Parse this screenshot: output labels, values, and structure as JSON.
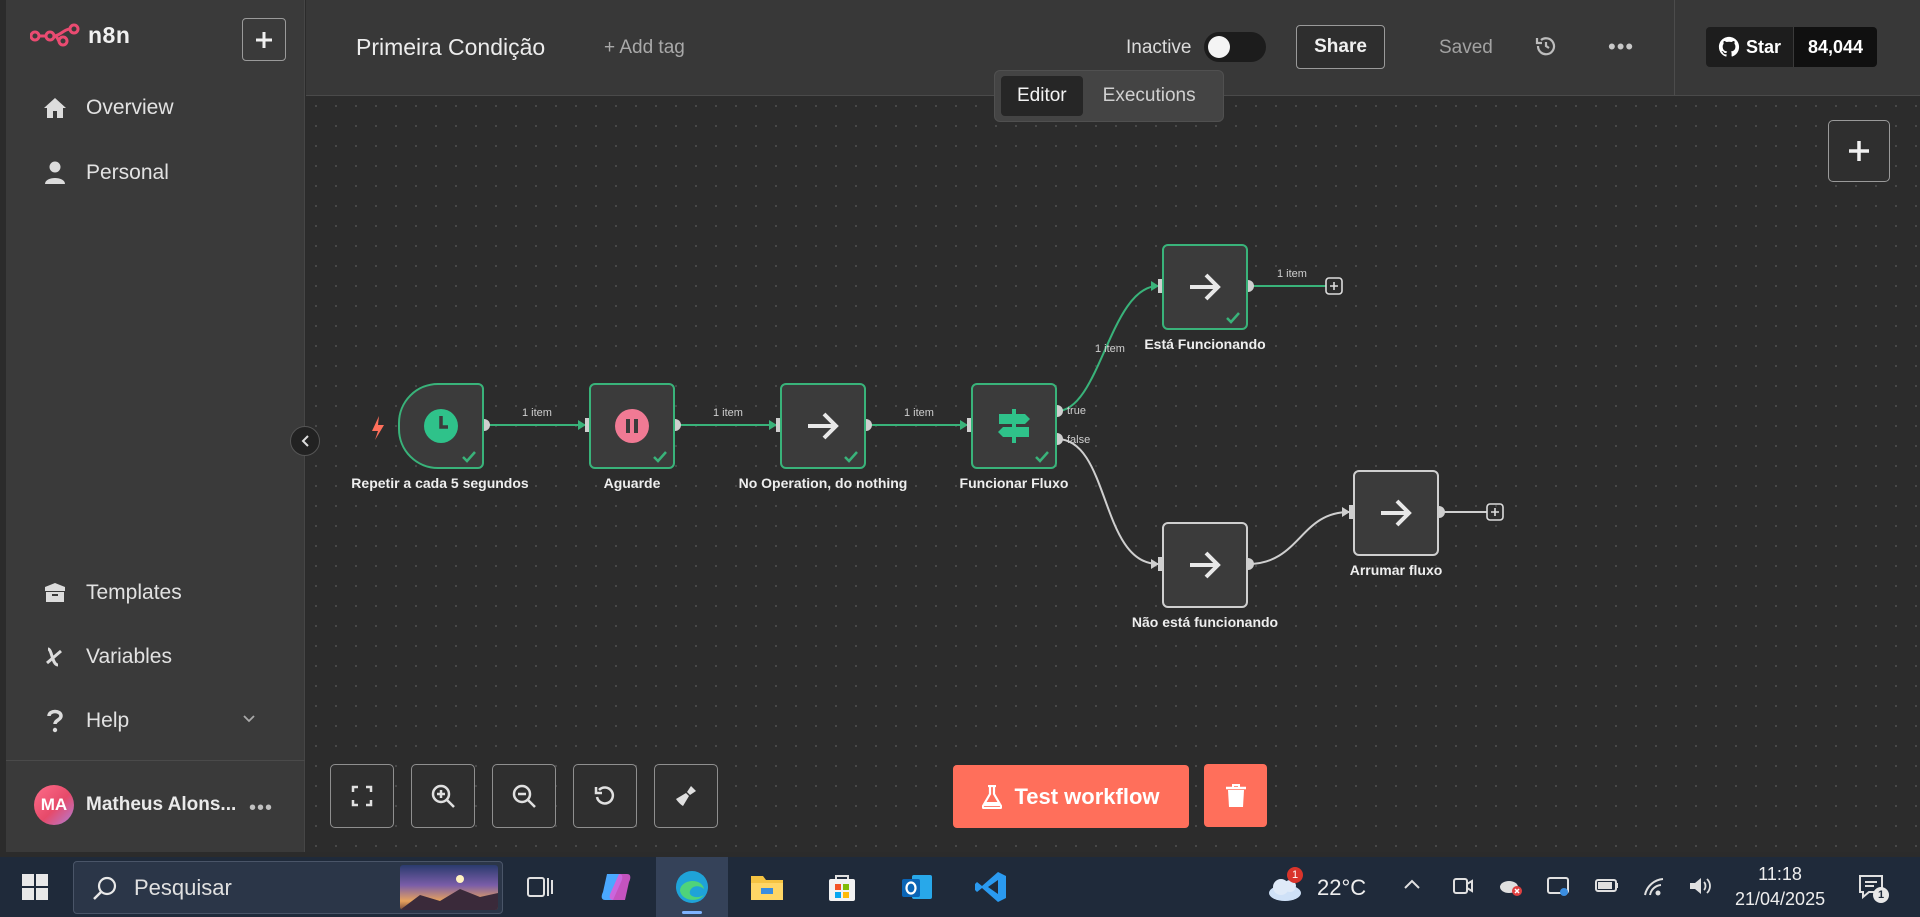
{
  "app": {
    "logo_text": "n8n",
    "nav": {
      "overview": "Overview",
      "personal": "Personal",
      "templates": "Templates",
      "variables": "Variables",
      "help": "Help"
    },
    "user": {
      "initials": "MA",
      "name": "Matheus Alons..."
    }
  },
  "header": {
    "workflow_name": "Primeira Condição",
    "add_tag": "+ Add tag",
    "status_label": "Inactive",
    "share_label": "Share",
    "saved_label": "Saved",
    "github": {
      "star_label": "Star",
      "count": "84,044"
    }
  },
  "tabs": {
    "editor": "Editor",
    "executions": "Executions",
    "active": "Editor"
  },
  "workflow": {
    "nodes": [
      {
        "id": "trigger",
        "label": "Repetir a cada 5 segundos",
        "icon": "clock-icon",
        "status": "success"
      },
      {
        "id": "wait",
        "label": "Aguarde",
        "icon": "pause-icon",
        "status": "success"
      },
      {
        "id": "noop",
        "label": "No Operation, do nothing",
        "icon": "arrow-right-icon",
        "status": "success"
      },
      {
        "id": "if",
        "label": "Funcionar Fluxo",
        "icon": "signpost-icon",
        "status": "success"
      },
      {
        "id": "ok",
        "label": "Está Funcionando",
        "icon": "arrow-right-icon",
        "status": "success"
      },
      {
        "id": "notok",
        "label": "Não está funcionando",
        "icon": "arrow-right-icon",
        "status": "idle"
      },
      {
        "id": "fix",
        "label": "Arrumar fluxo",
        "icon": "arrow-right-icon",
        "status": "idle"
      }
    ],
    "edge_labels": {
      "e1": "1 item",
      "e2": "1 item",
      "e3": "1 item",
      "e4": "1 item",
      "e5": "1 item",
      "true_branch": "true",
      "false_branch": "false"
    }
  },
  "actions": {
    "test_workflow": "Test workflow"
  },
  "taskbar": {
    "search_placeholder": "Pesquisar",
    "weather_temp": "22°C",
    "weather_badge": "1",
    "time": "11:18",
    "date": "21/04/2025",
    "notification_count": "1"
  },
  "colors": {
    "accent": "#ff6f5b",
    "success": "#39b37a",
    "brand": "#ea4b71"
  }
}
